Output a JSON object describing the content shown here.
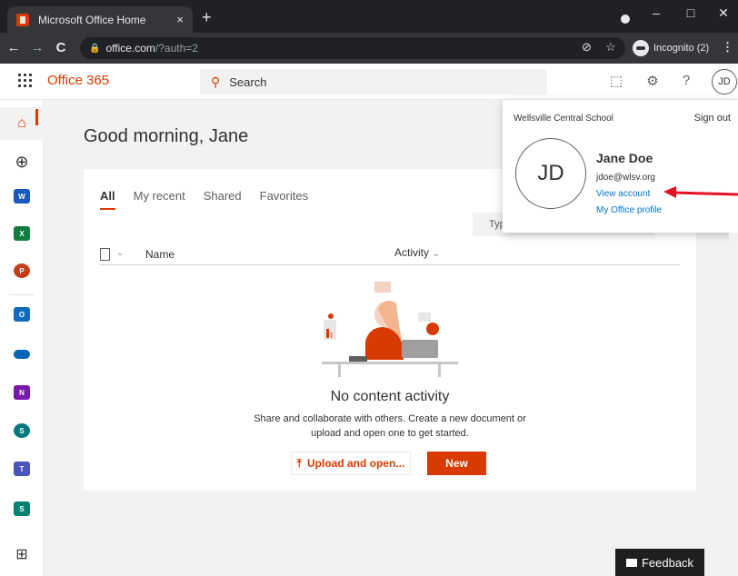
{
  "browser": {
    "tab_title": "Microsoft Office Home",
    "tab_close": "×",
    "new_tab": "+",
    "window_minimize": "–",
    "window_maximize": "□",
    "window_close": "✕",
    "back": "←",
    "forward": "→",
    "reload": "C",
    "url_host": "office.com",
    "url_path": "/?auth=2",
    "incognito_label": "Incognito (2)",
    "menu": "⋮"
  },
  "header": {
    "brand": "Office 365",
    "search_placeholder": "Search",
    "help": "?",
    "avatar_initials": "JD"
  },
  "main": {
    "greeting": "Good morning, Jane",
    "tabs": [
      {
        "label": "All"
      },
      {
        "label": "My recent"
      },
      {
        "label": "Shared"
      },
      {
        "label": "Favorites"
      }
    ],
    "filter_placeholder": "Typ",
    "columns": {
      "name": "Name",
      "activity": "Activity"
    },
    "empty_title": "No content activity",
    "empty_line1": "Share and collaborate with others. Create a new document or",
    "empty_line2": "upload and open one to get started.",
    "upload_label": "Upload and open...",
    "new_label": "New"
  },
  "account": {
    "org": "Wellsville Central School",
    "sign_out": "Sign out",
    "initials": "JD",
    "name": "Jane Doe",
    "email": "jdoe@wlsv.org",
    "view_account": "View account",
    "office_profile": "My Office profile"
  },
  "feedback_label": "Feedback",
  "colors": {
    "accent": "#d83b01",
    "link": "#0078d4",
    "arrow": "#e81123"
  }
}
